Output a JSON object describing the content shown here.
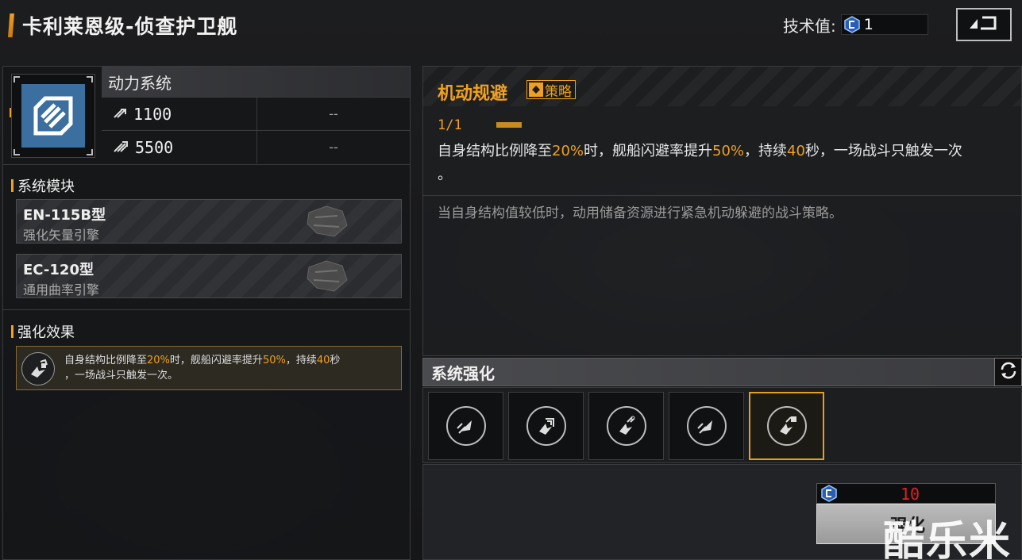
{
  "header": {
    "title": "卡利莱恩级-侦查护卫舰",
    "tech_label": "技术值:",
    "tech_value": "1"
  },
  "system": {
    "name": "动力系统",
    "stats": [
      {
        "value": "1100",
        "secondary": "--"
      },
      {
        "value": "5500",
        "secondary": "--"
      }
    ]
  },
  "modules": {
    "section_title": "系统模块",
    "items": [
      {
        "name": "EN-115B型",
        "sub": "强化矢量引擎"
      },
      {
        "name": "EC-120型",
        "sub": "通用曲率引擎"
      }
    ]
  },
  "effect": {
    "section_title": "强化效果",
    "parts": [
      "自身结构比例降至",
      "20%",
      "时，舰船闪避率提升",
      "50%",
      "，持续",
      "40",
      "秒",
      "，一场战斗只触发一次。"
    ]
  },
  "skill": {
    "title": "机动规避",
    "tag": "策略",
    "level": "1/1",
    "desc_parts": [
      "自身结构比例降至",
      "20%",
      "时，舰船闪避率提升",
      "50%",
      "，持续",
      "40",
      "秒，一场战斗只触发一次",
      "。"
    ],
    "flavor": "当自身结构值较低时，动用储备资源进行紧急机动躲避的战斗策略。"
  },
  "enhance": {
    "title": "系统强化",
    "slots": [
      {
        "icon": "jet-boost-icon",
        "active": false
      },
      {
        "icon": "jet-shield-icon",
        "active": false
      },
      {
        "icon": "jet-wrench-icon",
        "active": false
      },
      {
        "icon": "jet-boost-icon",
        "active": false
      },
      {
        "icon": "jet-gem-wrench-icon",
        "active": true
      }
    ],
    "cost": "10",
    "button_label": "强化"
  },
  "watermark": "酷乐米",
  "colors": {
    "accent": "#f0a020",
    "cost": "#e02020",
    "system_icon": "#3b6fa0"
  }
}
